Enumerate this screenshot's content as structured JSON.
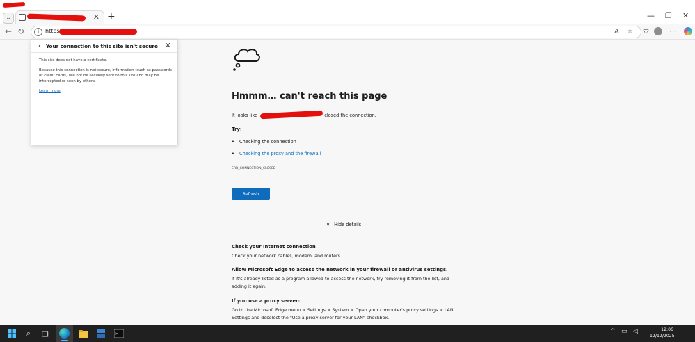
{
  "browser": {
    "url_prefix": "https://",
    "tab_close": "✕",
    "new_tab": "+",
    "window_controls": [
      "—",
      "❐",
      "✕"
    ]
  },
  "security_popup": {
    "title": "Your connection to this site isn't secure",
    "line1": "This site does not have a certificate.",
    "body": "Because this connection is not secure, information (such as passwords or credit cards) will not be securely sent to this site and may be intercepted or seen by others.",
    "learn_more": "Learn more"
  },
  "error_page": {
    "headline": "Hmmm… can't reach this page",
    "subline_start": "It looks like",
    "subline_end": "closed the connection.",
    "try_label": "Try:",
    "try_items": [
      {
        "text": "Checking the connection",
        "link": false
      },
      {
        "text": "Checking the proxy and the firewall",
        "link": true
      }
    ],
    "error_code": "ERR_CONNECTION_CLOSED",
    "refresh_label": "Refresh",
    "hide_details_label": "Hide details",
    "details": [
      {
        "heading": "Check your Internet connection",
        "text": "Check your network cables, modem, and routers."
      },
      {
        "heading": "Allow Microsoft Edge to access the network in your firewall or antivirus settings.",
        "text": "If it's already listed as a program allowed to access the network, try removing it from the list, and adding it again."
      },
      {
        "heading": "If you use a proxy server:",
        "text": "Go to the Microsoft Edge menu > Settings > System > Open your computer's proxy settings > LAN Settings and deselect the \"Use a proxy server for your LAN\" checkbox."
      }
    ]
  },
  "taskbar": {
    "time": "12:06",
    "date": "12/12/2025"
  },
  "colors": {
    "accent": "#0f6cbd",
    "redaction": "#e4100e",
    "taskbar": "#202020"
  }
}
